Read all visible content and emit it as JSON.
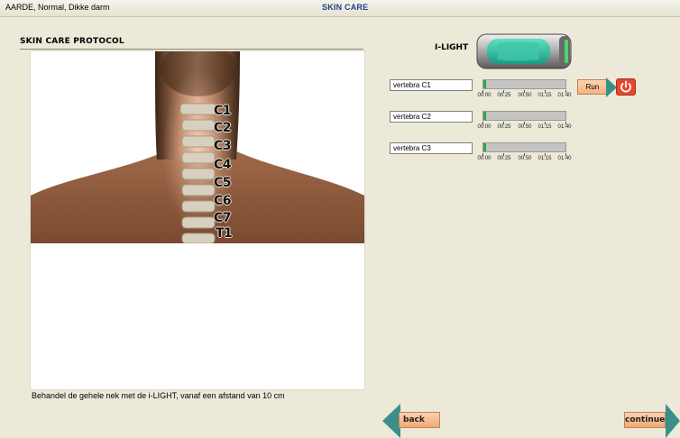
{
  "header": {
    "patient_info": "AARDE, Normal, Dikke darm",
    "screen_title": "SKIN CARE"
  },
  "protocol": {
    "title": "SKIN CARE PROTOCOL",
    "instruction": "Behandel de gehele nek met de i-LIGHT, vanaf een afstand van 10 cm",
    "vertebra_labels": [
      "C1",
      "C2",
      "C3",
      "C4",
      "C5",
      "C6",
      "C7",
      "T1"
    ]
  },
  "device": {
    "label": "I-LIGHT"
  },
  "treatments": [
    {
      "field": "vertebra C1",
      "progress": 0.02
    },
    {
      "field": "vertebra C2",
      "progress": 0.02
    },
    {
      "field": "vertebra C3",
      "progress": 0.02
    }
  ],
  "timeline_ticks": [
    "00:00",
    "00:25",
    "00:50",
    "01:15",
    "01:40"
  ],
  "controls": {
    "run_label": "Run",
    "back_label": "back",
    "continue_label": "continue"
  },
  "colors": {
    "accent_teal": "#3b8f8a",
    "button_orange": "#f4b27d",
    "power_red": "#e8462e",
    "progress_green": "#2fa64c",
    "title_blue": "#1f3f8f"
  }
}
